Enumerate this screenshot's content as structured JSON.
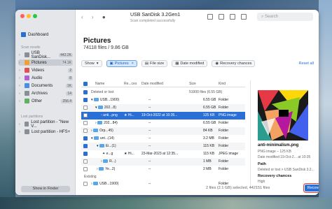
{
  "window": {
    "device_title": "USB  SanDisk 3.2Gen1",
    "device_subtitle": "Scan completed successfully"
  },
  "search": {
    "placeholder": "Search"
  },
  "sidebar": {
    "dashboard": "Dashboard",
    "scan_results_header": "Scan results",
    "items": [
      {
        "label": "USB  SanDisk...",
        "count": "442.2K",
        "icon_color": "#8a8f96"
      },
      {
        "label": "Pictures",
        "count": "74.1K",
        "icon_color": "#f0a030"
      },
      {
        "label": "Videos",
        "count": "2",
        "icon_color": "#e05050"
      },
      {
        "label": "Audio",
        "count": "8",
        "icon_color": "#b060d0"
      },
      {
        "label": "Documents",
        "count": "1K",
        "icon_color": "#4a90e2"
      },
      {
        "label": "Archives",
        "count": "14",
        "icon_color": "#8a8f96"
      },
      {
        "label": "Other",
        "count": "256.4",
        "icon_color": "#60b060"
      }
    ],
    "lost_header": "Lost partitions",
    "lost": [
      {
        "label": "Lost partition - \"New V..."
      },
      {
        "label": "Lost partition - HFS+"
      }
    ],
    "show_in_finder": "Show in Finder"
  },
  "main": {
    "title": "Pictures",
    "subtitle": "74118 files / 9.86 GB"
  },
  "filters": {
    "show": "Show",
    "pictures": "Pictures",
    "file_size": "File size",
    "date_modified": "Date modified",
    "recovery_chances": "Recovery chances",
    "reset_all": "Reset all"
  },
  "table": {
    "headers": {
      "name": "Name",
      "chances": "Re...ces",
      "date": "Date modified",
      "size": "Size",
      "kind": "Kind"
    },
    "rows": [
      {
        "name": "Deleted or lost",
        "chances": "",
        "date": "",
        "size": "51900 files (6.55 GB)",
        "kind": ""
      },
      {
        "name": "USB...1900)",
        "chances": "",
        "date": "--",
        "size": "6.55 GB",
        "kind": "Folder"
      },
      {
        "name": "202...8)",
        "chances": "",
        "date": "--",
        "size": "6.55 GB",
        "kind": "Folder"
      },
      {
        "name": "anti...png",
        "chances": "★ Hi...",
        "date": "19-Oct-2022 at 10:35...",
        "size": "125 KB",
        "kind": "PNG image"
      },
      {
        "name": "202...84)",
        "chances": "",
        "date": "--",
        "size": "6.55 GB",
        "kind": "Folder"
      },
      {
        "name": "Orp...45)",
        "chances": "",
        "date": "--",
        "size": "84 KB",
        "kind": "Folder"
      },
      {
        "name": "unt...(14)",
        "chances": "",
        "date": "--",
        "size": "3.2 MB",
        "kind": "Folder"
      },
      {
        "name": "Ei...(1)",
        "chances": "",
        "date": "--",
        "size": "115 KB",
        "kind": "Folder"
      },
      {
        "name": "e...g",
        "chances": "★ Hi...",
        "date": "23-Mar-2023 at 12:35...",
        "size": "115 KB",
        "kind": "JPEG image"
      },
      {
        "name": "R...)",
        "chances": "",
        "date": "--",
        "size": "1 MB",
        "kind": "Folder"
      },
      {
        "name": "Ye...2)",
        "chances": "",
        "date": "--",
        "size": "2 MB",
        "kind": "Folder"
      },
      {
        "name": "Existing",
        "chances": "",
        "date": "",
        "size": "",
        "kind": ""
      },
      {
        "name": "USB...1900)",
        "chances": "",
        "date": "--",
        "size": "",
        "kind": "Folder"
      }
    ]
  },
  "preview": {
    "name": "anti-minimalism.png",
    "info": "PNG image – 125 KB",
    "info2": "Date modified 19-Oct-2... at 10:35",
    "path_label": "Path",
    "path_value": "Deleted or lost > USB  SanDisk 3.2...",
    "chances_label": "Recovery chances",
    "chances_value": "High"
  },
  "status": {
    "text": "2 files (2.1 GB) selected, 442151 files"
  },
  "recover_button": "Recover"
}
